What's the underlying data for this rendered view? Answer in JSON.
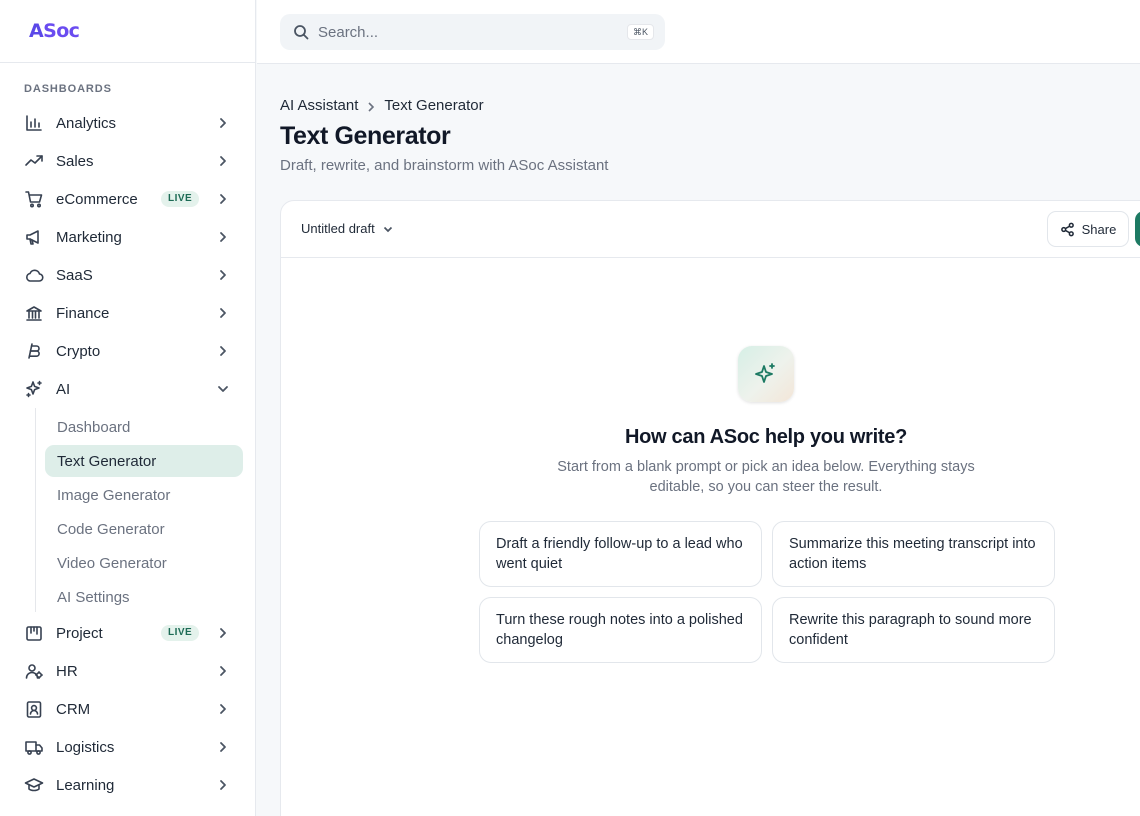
{
  "brand": {
    "logo_a": "A",
    "logo_rest": "Soc"
  },
  "sidebar": {
    "section": "DASHBOARDS",
    "items": [
      {
        "label": "Analytics",
        "icon": "bar-chart-icon"
      },
      {
        "label": "Sales",
        "icon": "trending-up-icon"
      },
      {
        "label": "eCommerce",
        "icon": "cart-icon",
        "badge": "LIVE"
      },
      {
        "label": "Marketing",
        "icon": "megaphone-icon"
      },
      {
        "label": "SaaS",
        "icon": "cloud-icon"
      },
      {
        "label": "Finance",
        "icon": "bank-icon"
      },
      {
        "label": "Crypto",
        "icon": "bitcoin-icon"
      },
      {
        "label": "AI",
        "icon": "sparkles-icon",
        "expanded": true
      },
      {
        "label": "Project",
        "icon": "kanban-icon",
        "badge": "LIVE"
      },
      {
        "label": "HR",
        "icon": "users-icon"
      },
      {
        "label": "CRM",
        "icon": "contact-icon"
      },
      {
        "label": "Logistics",
        "icon": "truck-icon"
      },
      {
        "label": "Learning",
        "icon": "graduation-cap-icon"
      }
    ],
    "ai_sub": [
      "Dashboard",
      "Text Generator",
      "Image Generator",
      "Code Generator",
      "Video Generator",
      "AI Settings"
    ],
    "ai_active": "Text Generator"
  },
  "search": {
    "placeholder": "Search...",
    "shortcut": "⌘K"
  },
  "breadcrumb": {
    "parent": "AI Assistant",
    "current": "Text Generator"
  },
  "page": {
    "title": "Text Generator",
    "subtitle": "Draft, rewrite, and brainstorm with ASoc Assistant"
  },
  "editor": {
    "draft_name": "Untitled draft",
    "share_label": "Share",
    "hero_title": "How can ASoc help you write?",
    "hero_desc": "Start from a blank prompt or pick an idea below. Everything stays editable, so you can steer the result.",
    "prompts": [
      "Draft a friendly follow-up to a lead who went quiet",
      "Summarize this meeting transcript into action items",
      "Turn these rough notes into a polished changelog",
      "Rewrite this paragraph to sound more confident"
    ]
  },
  "colors": {
    "accent": "#1d7a63",
    "active_bg": "#deeee9",
    "brand": "#5b48e8",
    "badge_bg": "#e4f2ec"
  }
}
